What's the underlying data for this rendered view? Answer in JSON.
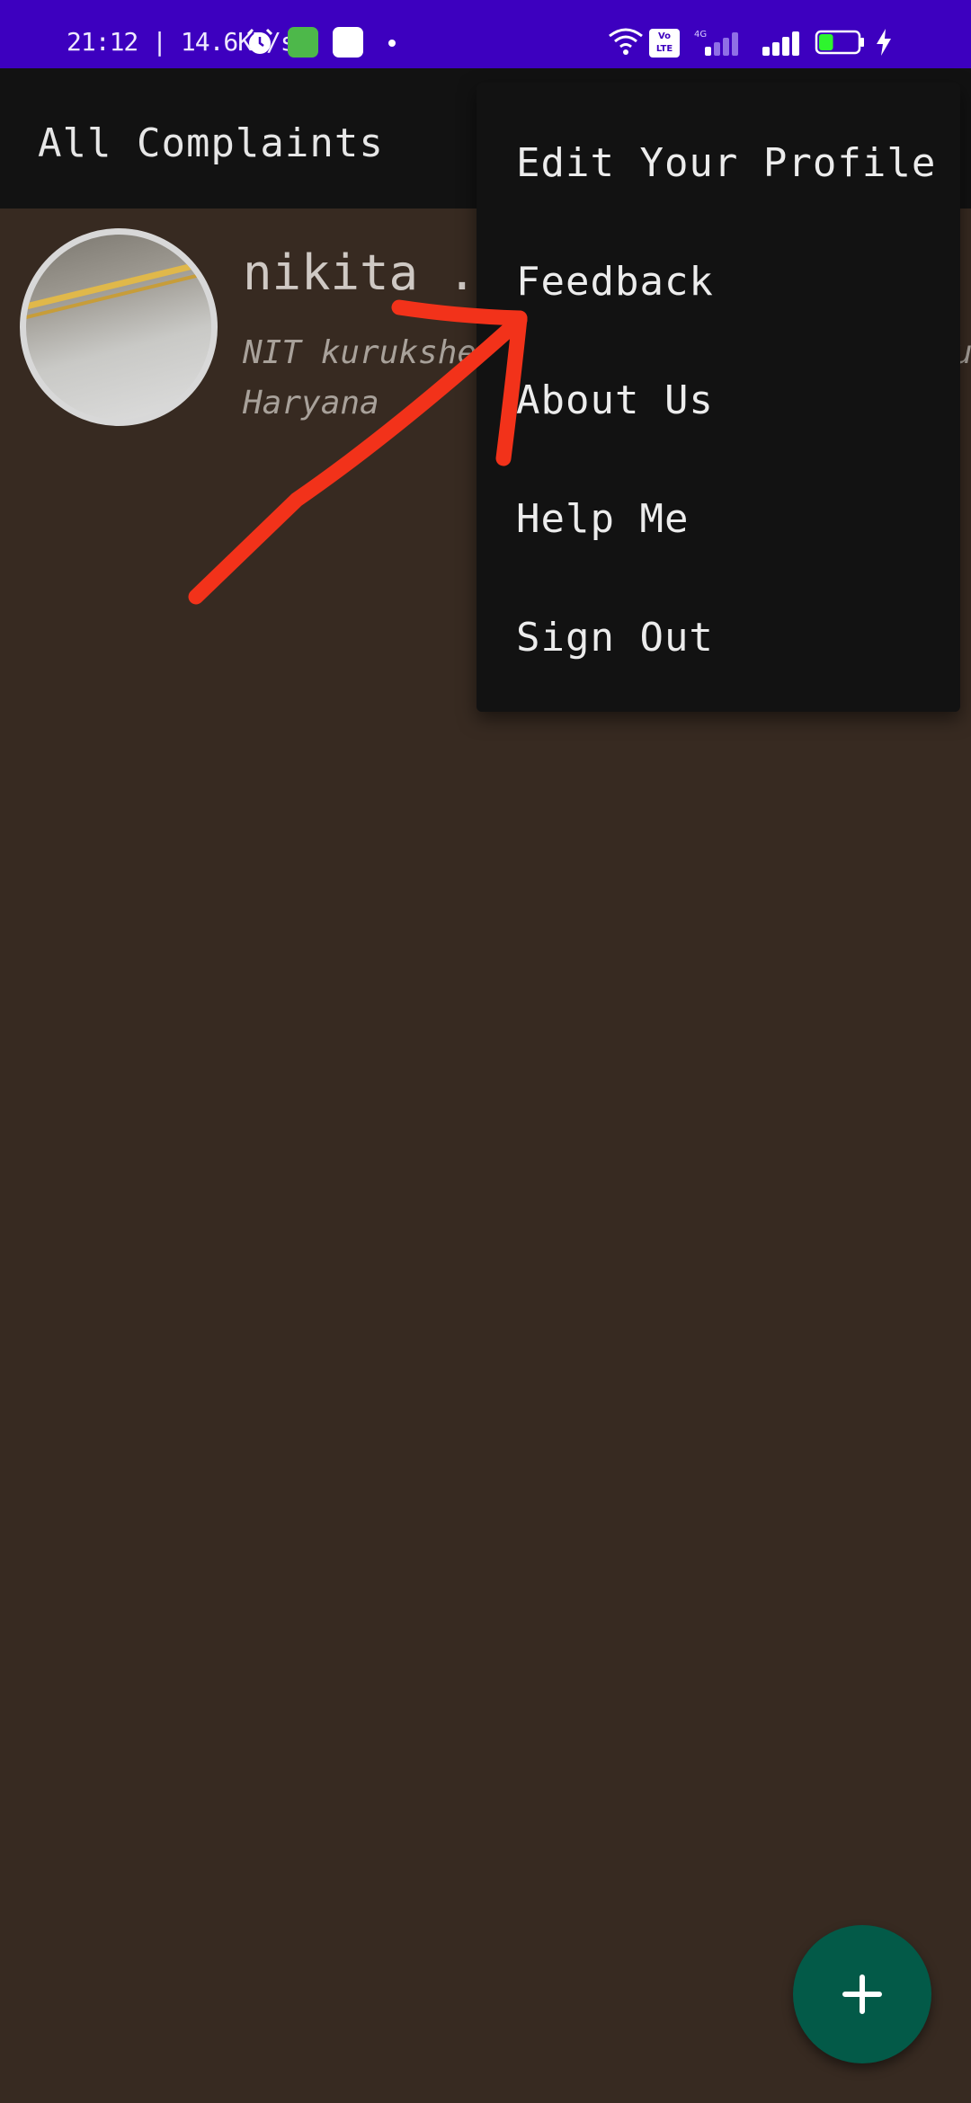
{
  "status_bar": {
    "time_speed": "21:12 | 14.6KB/s",
    "volte": "Vo\nLTE",
    "net_type": "4G",
    "battery_level": 37,
    "icons": [
      "alarm-icon",
      "app-icon",
      "app-icon",
      "dot-icon",
      "wifi-icon",
      "volte-icon",
      "signal-icon",
      "signal-icon",
      "battery-icon",
      "charging-bolt-icon"
    ]
  },
  "app_bar": {
    "title": "All Complaints"
  },
  "complaint": {
    "name": "nikita .",
    "location_line1": "NIT kurukshet",
    "location_line2": "Haryana",
    "right_partial": "u"
  },
  "menu": {
    "items": [
      "Edit Your Profile",
      "Feedback",
      "About Us",
      "Help Me",
      "Sign Out"
    ]
  },
  "fab": {
    "icon": "plus-icon"
  },
  "colors": {
    "status_bar": "#3d00bf",
    "background": "#372a21",
    "app_bar": "#121212",
    "menu": "#121212",
    "fab": "#035a48",
    "annotation": "#f2321a"
  }
}
